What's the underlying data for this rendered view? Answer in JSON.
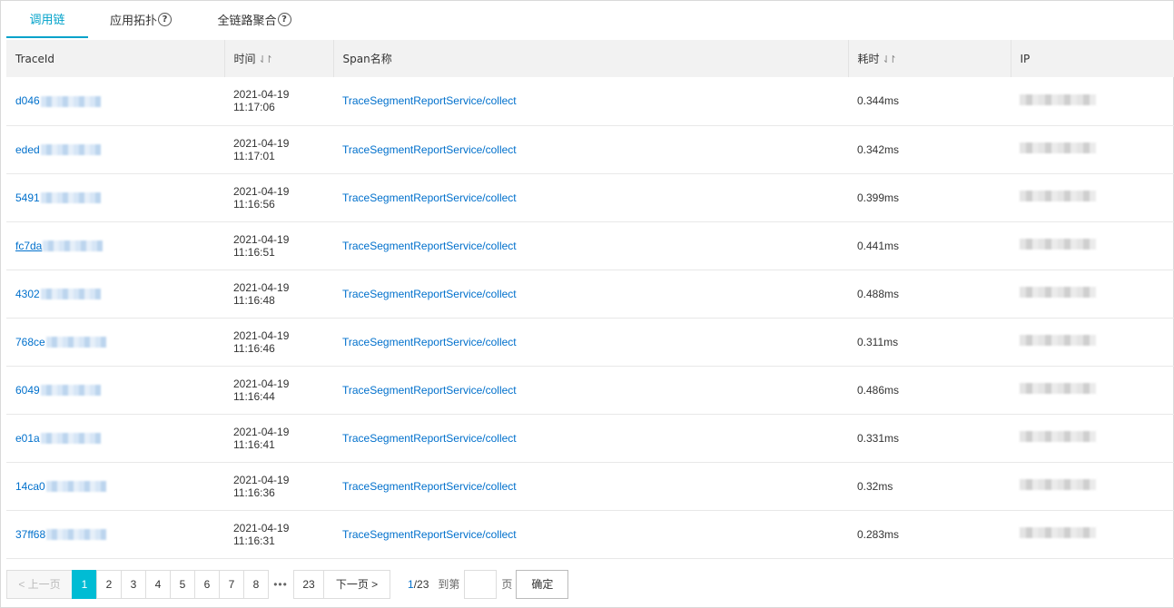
{
  "tabs": [
    {
      "label": "调用链",
      "help": false
    },
    {
      "label": "应用拓扑",
      "help": true
    },
    {
      "label": "全链路聚合",
      "help": true
    }
  ],
  "table": {
    "columns": [
      "TraceId",
      "时间",
      "Span名称",
      "耗时",
      "IP"
    ],
    "sort_icon": "⇃↾",
    "rows": [
      {
        "trace_prefix": "d046",
        "date": "2021-04-19",
        "time": "11:17:06",
        "span": "TraceSegmentReportService/collect",
        "duration": "0.344ms"
      },
      {
        "trace_prefix": "eded",
        "date": "2021-04-19",
        "time": "11:17:01",
        "span": "TraceSegmentReportService/collect",
        "duration": "0.342ms"
      },
      {
        "trace_prefix": "5491",
        "date": "2021-04-19",
        "time": "11:16:56",
        "span": "TraceSegmentReportService/collect",
        "duration": "0.399ms"
      },
      {
        "trace_prefix": "fc7da",
        "date": "2021-04-19",
        "time": "11:16:51",
        "span": "TraceSegmentReportService/collect",
        "duration": "0.441ms"
      },
      {
        "trace_prefix": "4302",
        "date": "2021-04-19",
        "time": "11:16:48",
        "span": "TraceSegmentReportService/collect",
        "duration": "0.488ms"
      },
      {
        "trace_prefix": "768ce",
        "date": "2021-04-19",
        "time": "11:16:46",
        "span": "TraceSegmentReportService/collect",
        "duration": "0.311ms"
      },
      {
        "trace_prefix": "6049",
        "date": "2021-04-19",
        "time": "11:16:44",
        "span": "TraceSegmentReportService/collect",
        "duration": "0.486ms"
      },
      {
        "trace_prefix": "e01a",
        "date": "2021-04-19",
        "time": "11:16:41",
        "span": "TraceSegmentReportService/collect",
        "duration": "0.331ms"
      },
      {
        "trace_prefix": "14ca0",
        "date": "2021-04-19",
        "time": "11:16:36",
        "span": "TraceSegmentReportService/collect",
        "duration": "0.32ms"
      },
      {
        "trace_prefix": "37ff68",
        "date": "2021-04-19",
        "time": "11:16:31",
        "span": "TraceSegmentReportService/collect",
        "duration": "0.283ms"
      }
    ]
  },
  "pagination": {
    "prev_label": "< 上一页",
    "pages": [
      "1",
      "2",
      "3",
      "4",
      "5",
      "6",
      "7",
      "8"
    ],
    "ellipsis": "•••",
    "last_page": "23",
    "next_label": "下一页 >",
    "current": "1",
    "total": "/23",
    "goto_label": "到第",
    "page_suffix": "页",
    "confirm_label": "确定"
  }
}
